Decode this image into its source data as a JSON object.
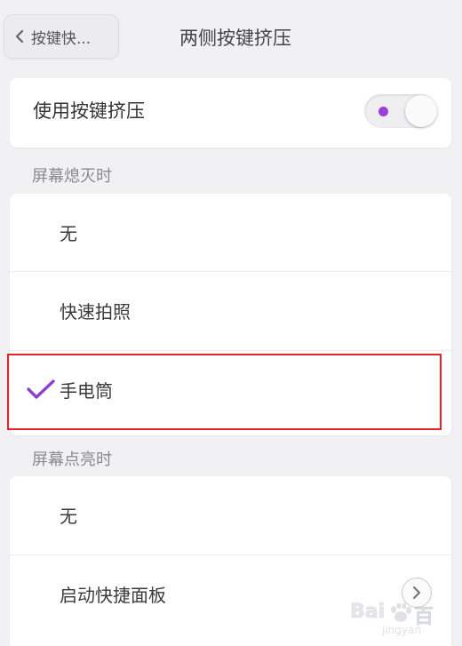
{
  "header": {
    "back_label": "按键快...",
    "title": "两侧按键挤压"
  },
  "toggle_row": {
    "label": "使用按键挤压",
    "enabled": true,
    "accent_color": "#9b3fd6"
  },
  "sections": {
    "screen_off": {
      "header": "屏幕熄灭时",
      "options": [
        {
          "label": "无"
        },
        {
          "label": "快速拍照"
        },
        {
          "label": "手电筒"
        }
      ],
      "selected": "手电筒"
    },
    "screen_on": {
      "header": "屏幕点亮时",
      "options": [
        {
          "label": "无"
        },
        {
          "label": "启动快捷面板"
        }
      ]
    }
  },
  "annotation": {
    "highlight_color": "#e0252b"
  },
  "watermark": {
    "brand": "Bai",
    "sub": "jingyan"
  }
}
